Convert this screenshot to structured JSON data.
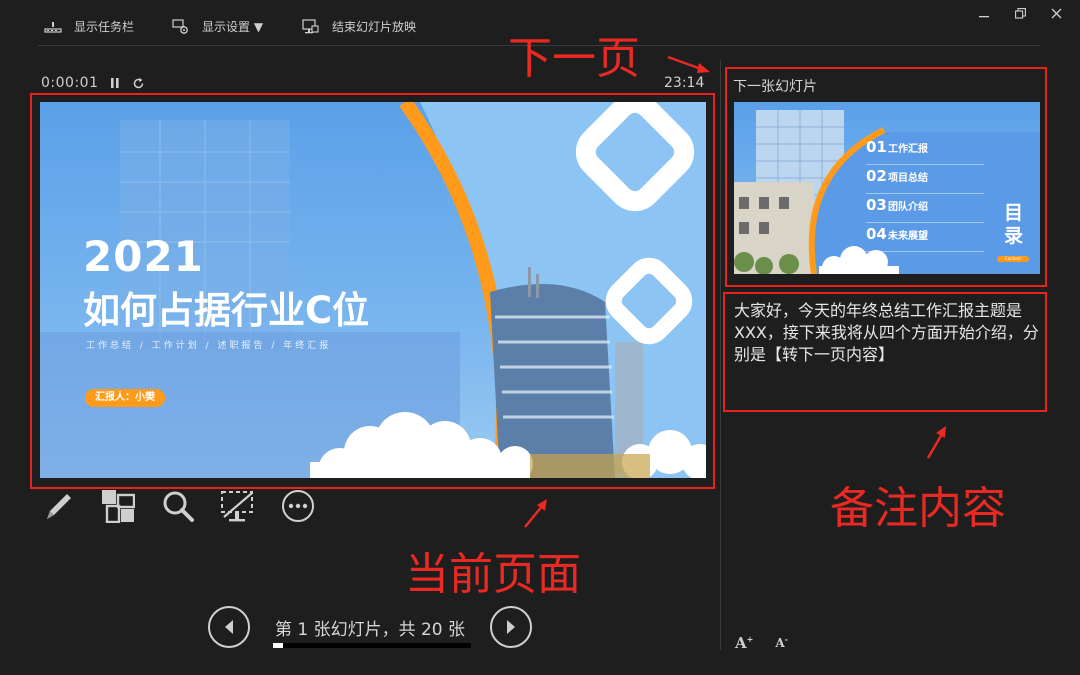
{
  "toolbar": {
    "taskbar_label": "显示任务栏",
    "display_settings_label": "显示设置 ▼",
    "end_show_label": "结束幻灯片放映"
  },
  "timer": {
    "elapsed": "0:00:01",
    "clock": "23:14"
  },
  "current_slide": {
    "title": "2021",
    "subtitle": "如何占据行业C位",
    "tagline": "工作总结 / 工作计划 / 述职报告 / 年终汇报",
    "reporter": "汇报人：小樊"
  },
  "next_slide": {
    "label": "下一张幻灯片",
    "toc": [
      {
        "num": "01",
        "label": "工作汇报"
      },
      {
        "num": "02",
        "label": "项目总结"
      },
      {
        "num": "03",
        "label": "团队介绍"
      },
      {
        "num": "04",
        "label": "未来展望"
      }
    ],
    "side_title": "目录",
    "contact": "Content"
  },
  "notes": {
    "text": "大家好，今天的年终总结工作汇报主题是XXX，接下来我将从四个方面开始介绍，分别是【转下一页内容】"
  },
  "navigator": {
    "text": "第 1 张幻灯片，共 20 张",
    "current": 1,
    "total": 20,
    "progress": 0.05
  },
  "annotations": {
    "next": "下一页",
    "notes": "备注内容",
    "current": "当前页面"
  },
  "colors": {
    "annotation": "#ea2a22",
    "accent": "#ff9a1a",
    "slide_blue": "#5aa0e8"
  }
}
